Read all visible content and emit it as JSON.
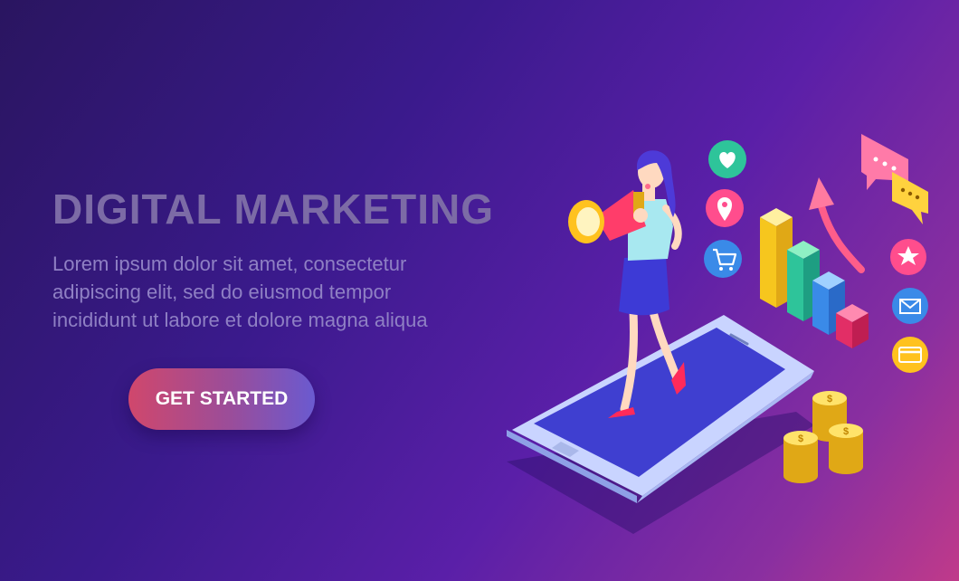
{
  "hero": {
    "title": "DIGITAL MARKETING",
    "description_lines": [
      "Lorem ipsum dolor sit amet, consectetur",
      "adipiscing elit, sed do eiusmod tempor",
      "incididunt ut labore et dolore magna aliqua"
    ],
    "cta_label": "GET STARTED"
  },
  "illustration": {
    "icons": [
      "heart-icon",
      "location-pin-icon",
      "shopping-cart-icon",
      "star-icon",
      "mail-icon",
      "credit-card-icon",
      "chat-bubbles-icon",
      "megaphone-icon",
      "growth-arrow-icon",
      "dollar-coin-icon"
    ],
    "coin_symbol": "$"
  },
  "colors": {
    "background_start": "#2a1560",
    "background_end": "#c03a8a",
    "title": "#7c6ba6",
    "body_text": "#8f80c4",
    "button_start": "#d0476c",
    "button_end": "#6a5ad0"
  }
}
